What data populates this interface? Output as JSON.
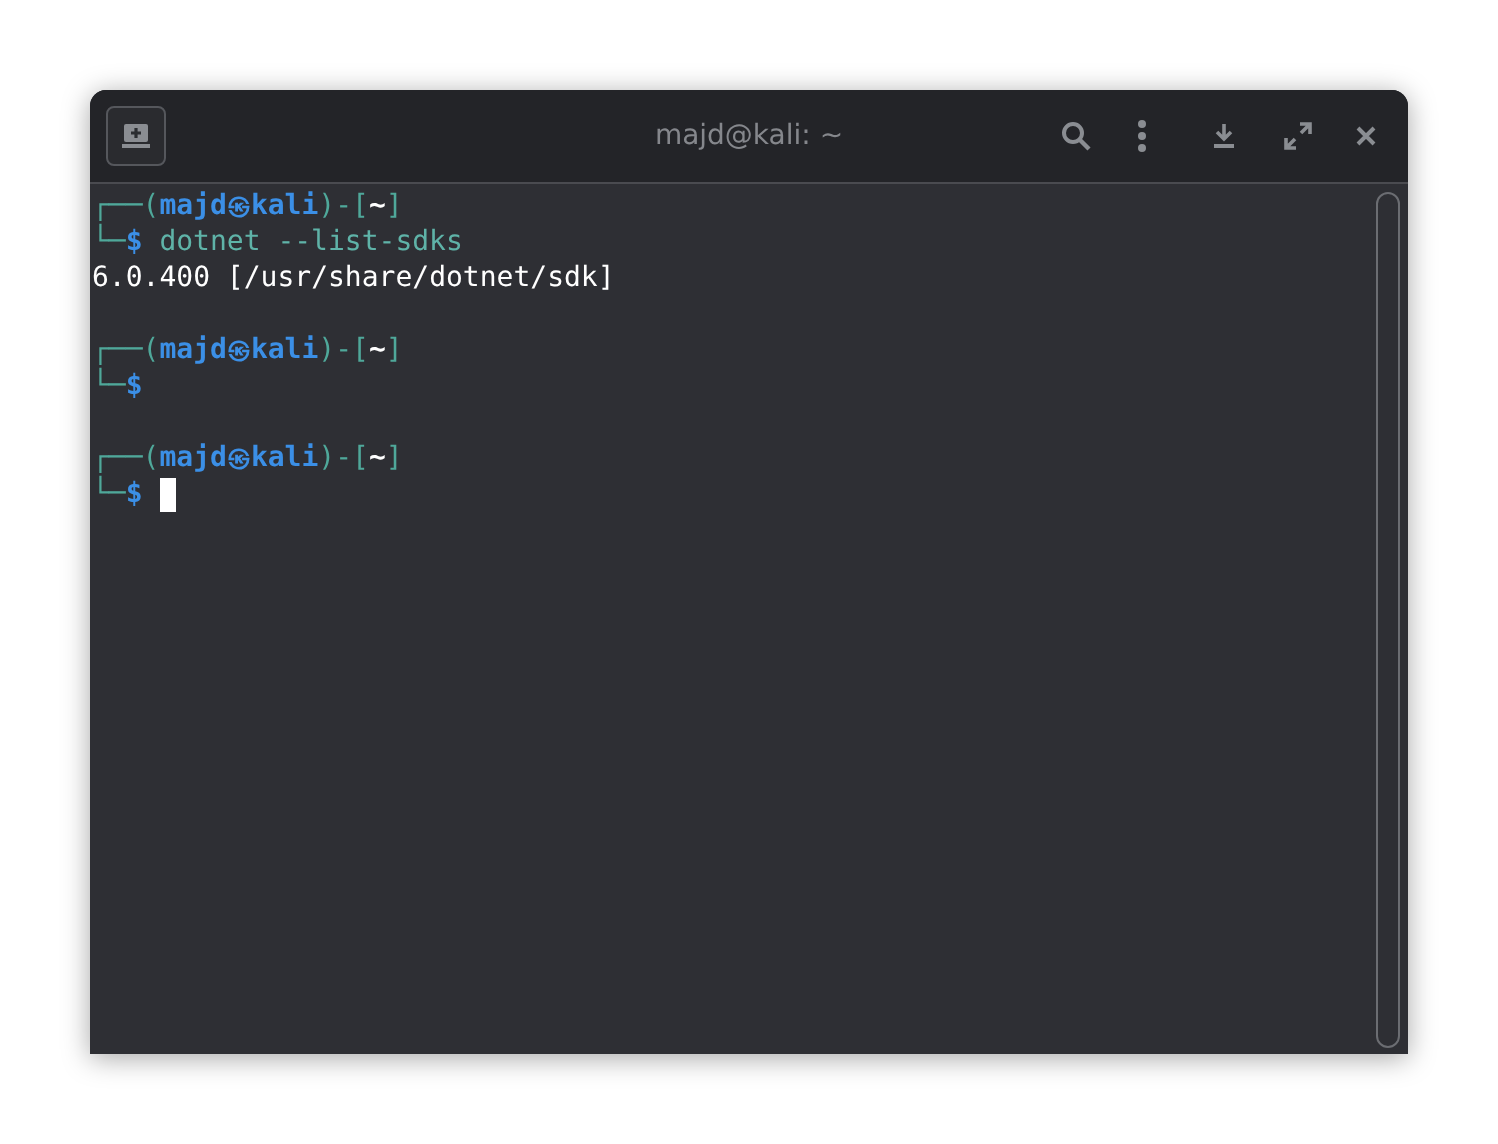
{
  "window": {
    "title": "majd@kali: ~"
  },
  "prompts": [
    {
      "top_prefix": "┌──(",
      "user": "majd",
      "at": "㉿",
      "host": "kali",
      "mid": ")-[",
      "dir": "~",
      "close": "]",
      "bottom_prefix": "└─",
      "sign": "$",
      "command": "dotnet --list-sdks",
      "output": [
        "6.0.400 [/usr/share/dotnet/sdk]"
      ],
      "cursor": false
    },
    {
      "top_prefix": "┌──(",
      "user": "majd",
      "at": "㉿",
      "host": "kali",
      "mid": ")-[",
      "dir": "~",
      "close": "]",
      "bottom_prefix": "└─",
      "sign": "$",
      "cursor": false
    },
    {
      "top_prefix": "┌──(",
      "user": "majd",
      "at": "㉿",
      "host": "kali",
      "mid": ")-[",
      "dir": "~",
      "close": "]",
      "bottom_prefix": "└─",
      "sign": "$",
      "cursor": true
    }
  ]
}
